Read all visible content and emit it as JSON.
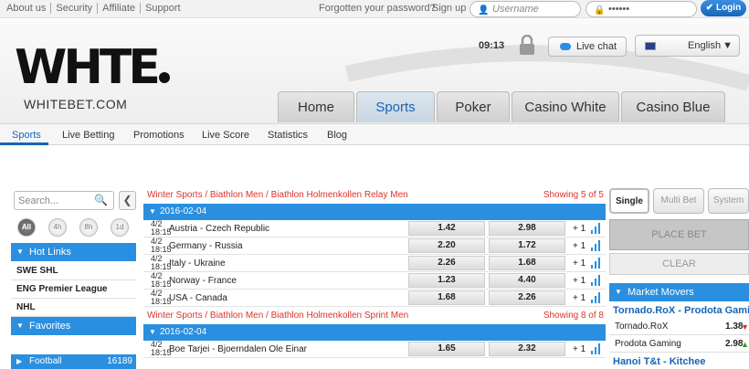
{
  "topbar": {
    "links": [
      "About us",
      "Security",
      "Affiliate",
      "Support"
    ],
    "forgot": "Forgotten your password?",
    "signup": "Sign up",
    "username_placeholder": "Username",
    "password_mask": "••••••",
    "login": "Login"
  },
  "header": {
    "logo_text": "WHTE",
    "logo_sub": "WHITEBET.COM",
    "time": "09:13",
    "live_chat": "Live chat",
    "language": "English"
  },
  "tabs": [
    "Home",
    "Sports",
    "Poker",
    "Casino White",
    "Casino Blue"
  ],
  "subnav": [
    "Sports",
    "Live Betting",
    "Promotions",
    "Live Score",
    "Statistics",
    "Blog"
  ],
  "sidebar": {
    "search_placeholder": "Search...",
    "filters": [
      "All",
      "4h",
      "8h",
      "1d"
    ],
    "hot_links": "Hot Links",
    "items": [
      "SWE SHL",
      "ENG Premier League",
      "NHL"
    ],
    "favorites": "Favorites",
    "football": "Football",
    "football_count": "16189"
  },
  "events": [
    {
      "crumb": "Winter Sports / Biathlon Men / Biathlon Holmenkollen Relay Men",
      "showing": "Showing 5 of 5",
      "date": "2016-02-04",
      "rows": [
        {
          "date": "4/2",
          "time": "18:15",
          "match": "Austria - Czech Republic",
          "odd1": "1.42",
          "odd2": "2.98",
          "more": "+ 1"
        },
        {
          "date": "4/2",
          "time": "18:15",
          "match": "Germany - Russia",
          "odd1": "2.20",
          "odd2": "1.72",
          "more": "+ 1"
        },
        {
          "date": "4/2",
          "time": "18:15",
          "match": "Italy - Ukraine",
          "odd1": "2.26",
          "odd2": "1.68",
          "more": "+ 1"
        },
        {
          "date": "4/2",
          "time": "18:15",
          "match": "Norway - France",
          "odd1": "1.23",
          "odd2": "4.40",
          "more": "+ 1"
        },
        {
          "date": "4/2",
          "time": "18:15",
          "match": "USA - Canada",
          "odd1": "1.68",
          "odd2": "2.26",
          "more": "+ 1"
        }
      ]
    },
    {
      "crumb": "Winter Sports / Biathlon Men / Biathlon Holmenkollen Sprint Men",
      "showing": "Showing 8 of 8",
      "date": "2016-02-04",
      "rows": [
        {
          "date": "4/2",
          "time": "18:15",
          "match": "Boe Tarjei - Bjoerndalen Ole Einar",
          "odd1": "1.65",
          "odd2": "2.32",
          "more": "+ 1"
        }
      ]
    }
  ],
  "betslip": {
    "modes": [
      "Single",
      "Multi Bet",
      "System"
    ],
    "place_bet": "PLACE BET",
    "clear": "CLEAR",
    "market_movers": "Market Movers",
    "movers": [
      {
        "title": "Tornado.RoX - Prodota Gaming",
        "rows": [
          {
            "name": "Tornado.RoX",
            "value": "1.38",
            "dir": "down"
          },
          {
            "name": "Prodota Gaming",
            "value": "2.98",
            "dir": "up"
          }
        ]
      },
      {
        "title": "Hanoi T&t - Kitchee",
        "rows": []
      }
    ]
  },
  "colors": {
    "accent": "#2a8fe0",
    "link_red": "#d9342b",
    "brand_blue": "#1565b8"
  }
}
